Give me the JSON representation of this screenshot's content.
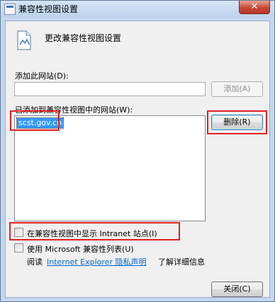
{
  "window": {
    "title": "兼容性视图设置",
    "close_glyph": "✕"
  },
  "header": {
    "text": "更改兼容性视图设置",
    "icon": "document-settings-icon"
  },
  "add_site": {
    "label": "添加此网站(D):",
    "input_value": "",
    "button_label": "添加(A)"
  },
  "site_list": {
    "label": "已添加到兼容性视图中的网站(W):",
    "items": [
      "scst.gov.cn"
    ],
    "remove_button_label": "删除(R)"
  },
  "options": {
    "intranet_label": "在兼容性视图中显示 Intranet 站点(I)",
    "intranet_checked": false,
    "ms_list_label": "使用 Microsoft 兼容性列表(U)",
    "ms_list_checked": false,
    "read_prefix": "阅读",
    "privacy_link": "Internet Explorer 隐私声明",
    "read_suffix": "了解详细信息"
  },
  "footer": {
    "close_button_label": "关闭(C)"
  },
  "colors": {
    "highlight_box": "#e02020",
    "selection": "#3399ff",
    "link": "#0066cc"
  }
}
